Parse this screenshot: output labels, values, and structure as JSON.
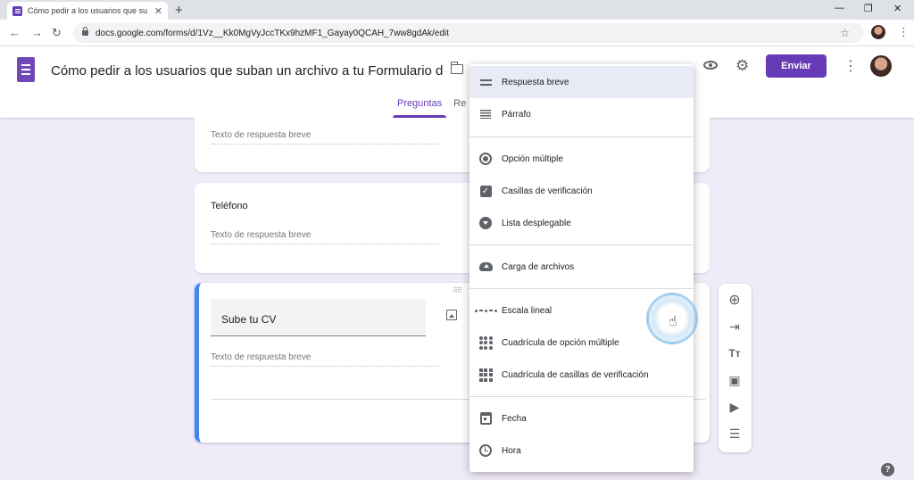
{
  "browser": {
    "tab_title": "Cómo pedir a los usuarios que su",
    "tab_close": "✕",
    "new_tab": "+",
    "url": "docs.google.com/forms/d/1Vz__Kk0MgVyJccTKx9hzMF1_Gayay0QCAH_7ww8gdAk/edit",
    "win_minimize": "—",
    "win_restore": "❐",
    "win_close": "✕"
  },
  "header": {
    "form_title": "Cómo pedir a los usuarios que suban un archivo a tu Formulario de Goog",
    "send_label": "Enviar",
    "tabs": [
      {
        "label": "Preguntas"
      },
      {
        "label": "Re"
      }
    ]
  },
  "cards": {
    "card1_placeholder": "Texto de respuesta breve",
    "card2_title": "Teléfono",
    "card2_placeholder": "Texto de respuesta breve",
    "card3_question": "Sube tu CV",
    "card3_placeholder": "Texto de respuesta breve"
  },
  "menu": {
    "items": [
      {
        "label": "Respuesta breve",
        "icon": "short-answer-icon"
      },
      {
        "label": "Párrafo",
        "icon": "paragraph-icon"
      },
      {
        "label": "Opción múltiple",
        "icon": "radio-icon"
      },
      {
        "label": "Casillas de verificación",
        "icon": "checkbox-icon"
      },
      {
        "label": "Lista desplegable",
        "icon": "dropdown-icon"
      },
      {
        "label": "Carga de archivos",
        "icon": "cloud-upload-icon"
      },
      {
        "label": "Escala lineal",
        "icon": "linear-scale-icon"
      },
      {
        "label": "Cuadrícula de opción múltiple",
        "icon": "radio-grid-icon"
      },
      {
        "label": "Cuadrícula de casillas de verificación",
        "icon": "checkbox-grid-icon"
      },
      {
        "label": "Fecha",
        "icon": "calendar-icon"
      },
      {
        "label": "Hora",
        "icon": "clock-icon"
      }
    ],
    "selected": "Respuesta breve"
  },
  "side_toolbar": {
    "text_label": "Tт"
  },
  "help": "?",
  "colors": {
    "accent": "#673ab7",
    "background": "#f0ebf8",
    "active_border": "#4285f4"
  }
}
